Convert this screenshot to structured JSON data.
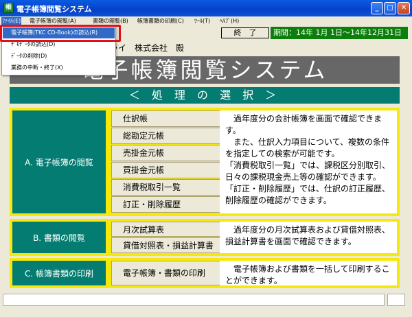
{
  "window": {
    "title": "電子帳簿閲覧システム",
    "icon_text": "帳",
    "minimize": "_",
    "maximize": "□",
    "close": "✕"
  },
  "menubar": [
    {
      "label": "ﾌｧｲﾙ(E)"
    },
    {
      "label": "電子帳簿の閲覧(A)"
    },
    {
      "label": "書類の閲覧(B)"
    },
    {
      "label": "帳簿書類の印刷(C)"
    },
    {
      "label": "ﾂｰﾙ(T)"
    },
    {
      "label": "ﾍﾙﾌﾟ(H)"
    }
  ],
  "file_menu": [
    {
      "label": "電子帳簿(TKC CD-Book)の読込(R)"
    },
    {
      "label": "ﾃﾞﾓﾃﾞｰﾀの読込(D)"
    },
    {
      "label": "ﾃﾞｰﾀの削除(D)"
    },
    {
      "label": "業務の中断・終了(X)"
    }
  ],
  "toolbar": {
    "end_label": "終　了",
    "period": "期間：14年 1月 1日〜14年12月31日"
  },
  "company": "ライ　株式会社　殿",
  "main_title": "電子帳簿閲覧システム",
  "section_title": "＜ 処 理 の 選 択 ＞",
  "groups": {
    "a": {
      "label": "A. 電子帳簿の閲覧",
      "buttons": [
        "仕訳帳",
        "総勘定元帳",
        "売掛金元帳",
        "買掛金元帳",
        "消費税取引一覧",
        "訂正・削除履歴"
      ],
      "desc": "　過年度分の会計帳簿を画面で確認できます。\n　また、仕訳入力項目について、複数の条件を指定しての検索が可能です。\n「消費税取引一覧」では、課税区分別取引、日々の課税現金売上等の確認ができます。\n「訂正・削除履歴」では、仕訳の訂正履歴、削除履歴の確認ができます。"
    },
    "b": {
      "label": "B. 書類の閲覧",
      "buttons": [
        "月次試算表",
        "貸借対照表・損益計算書"
      ],
      "desc": "　過年度分の月次試算表および貸借対照表、損益計算書を画面で確認できます。"
    },
    "c": {
      "label": "C. 帳簿書類の印刷",
      "buttons": [
        "電子帳簿・書類の印刷"
      ],
      "desc": "　電子帳簿および書類を一括して印刷することができます。"
    }
  },
  "status": {
    "text": ""
  }
}
